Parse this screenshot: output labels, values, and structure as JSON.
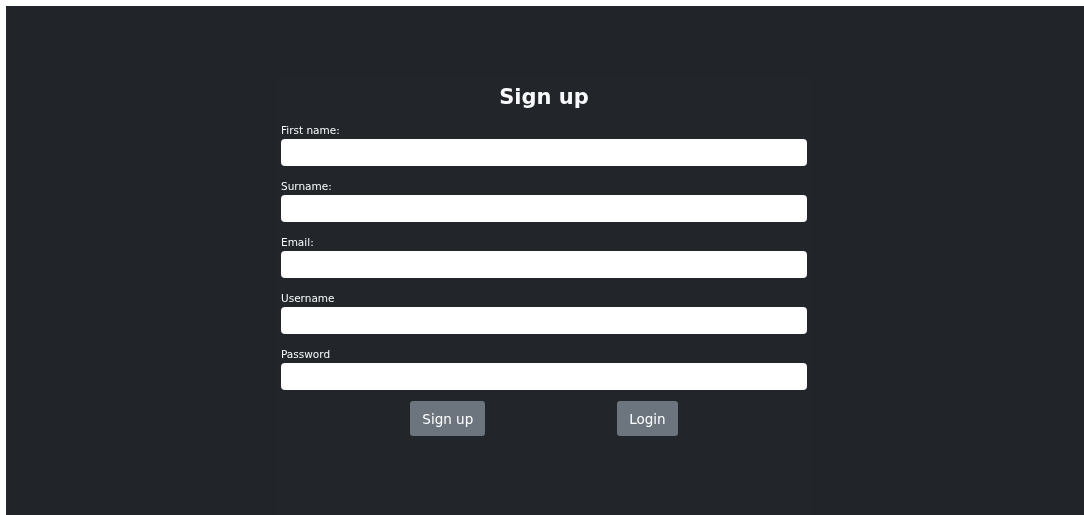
{
  "title": "Sign up",
  "fields": [
    {
      "label": "First name:"
    },
    {
      "label": "Surname:"
    },
    {
      "label": "Email:"
    },
    {
      "label": "Username"
    },
    {
      "label": "Password"
    }
  ],
  "buttons": [
    {
      "label": "Sign up"
    },
    {
      "label": "Login"
    }
  ]
}
